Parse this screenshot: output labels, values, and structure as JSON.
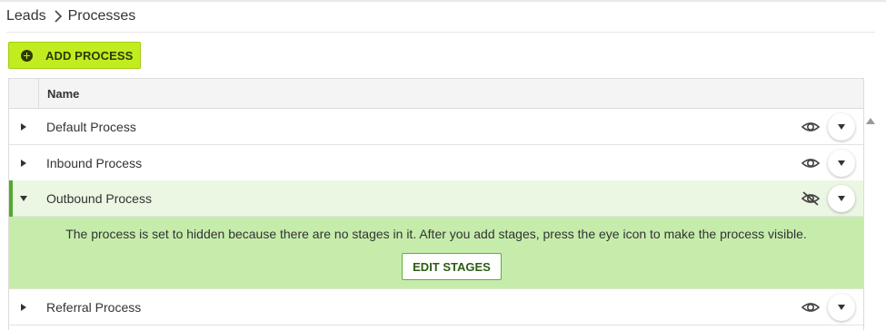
{
  "breadcrumb": {
    "parent": "Leads",
    "separator_icon": "chevron-right-icon",
    "current": "Processes"
  },
  "toolbar": {
    "add_process_label": "ADD PROCESS",
    "add_process_icon": "plus-circle-icon",
    "accent_color": "#c1ec1f"
  },
  "table": {
    "columns": [
      "Name"
    ],
    "rows": [
      {
        "name": "Default Process",
        "expanded": false,
        "visibility": "visible",
        "visibility_icon": "eye-icon"
      },
      {
        "name": "Inbound Process",
        "expanded": false,
        "visibility": "visible",
        "visibility_icon": "eye-icon"
      },
      {
        "name": "Outbound Process",
        "expanded": true,
        "visibility": "hidden",
        "visibility_icon": "eye-off-icon"
      },
      {
        "name": "Referral Process",
        "expanded": false,
        "visibility": "visible",
        "visibility_icon": "eye-icon"
      }
    ],
    "expanded_detail": {
      "message": "The process is set to hidden because there are no stages in it. After you add stages, press the eye icon to make the process visible.",
      "edit_stages_label": "EDIT STAGES"
    }
  },
  "colors": {
    "expanded_row_bg": "#ebf7e3",
    "detail_bg": "#c6ecab",
    "expanded_accent": "#53a832"
  }
}
